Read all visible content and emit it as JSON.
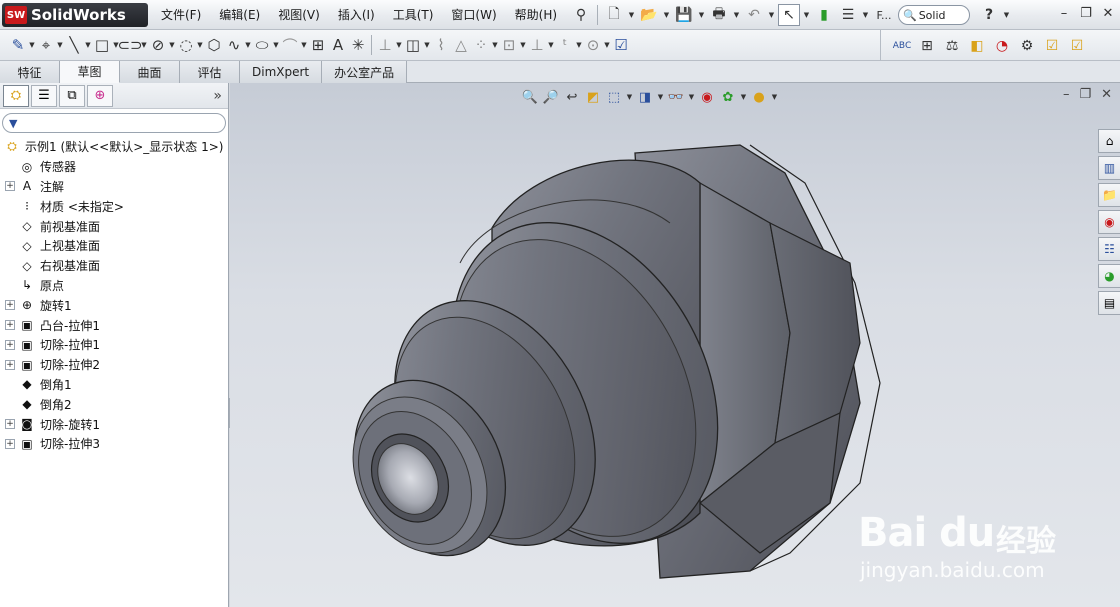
{
  "app": {
    "logo_badge": "SW",
    "logo_name": "SolidWorks"
  },
  "menu": [
    "文件(F)",
    "编辑(E)",
    "视图(V)",
    "插入(I)",
    "工具(T)",
    "窗口(W)",
    "帮助(H)"
  ],
  "menubar_toolbar": {
    "icons": [
      "pin-icon",
      "new-document-icon",
      "open-icon",
      "save-icon",
      "print-icon",
      "undo-icon",
      "select-icon",
      "traffic-light-icon",
      "options-icon",
      "rebuild-icon"
    ],
    "rebuild_label": "F...",
    "search_text": "Solid",
    "help_glyph": "?"
  },
  "window_controls": [
    "–",
    "❐",
    "✕"
  ],
  "sketch_toolbar": {
    "icons": [
      "sketch-icon",
      "smart-dimension-icon",
      "line-icon",
      "rectangle-icon",
      "slot-icon",
      "circle-icon",
      "center-arc-icon",
      "polygon-icon",
      "spline-icon",
      "ellipse-icon",
      "fillet-sketch-icon",
      "text-icon",
      "point-icon",
      "mirror-icon",
      "offset-icon",
      "trim-icon",
      "construction-icon",
      "linear-pattern-icon",
      "move-icon",
      "relations-icon",
      "repair-icon",
      "quick-snaps-icon"
    ]
  },
  "evaluate_toolbar": {
    "icons": [
      "spell-check-icon",
      "measure-icon",
      "mass-properties-icon",
      "section-properties-icon",
      "statistics-icon",
      "check-icon",
      "checkbox-icon"
    ]
  },
  "tabs": [
    {
      "label": "特征",
      "active": false
    },
    {
      "label": "草图",
      "active": true
    },
    {
      "label": "曲面",
      "active": false
    },
    {
      "label": "评估",
      "active": false
    },
    {
      "label": "DimXpert",
      "active": false
    },
    {
      "label": "办公室产品",
      "active": false
    }
  ],
  "feature_manager": {
    "panel_tabs": [
      "feature-manager-icon",
      "property-manager-icon",
      "configuration-manager-icon",
      "dimxpert-manager-icon"
    ],
    "more": "»",
    "root": "示例1  (默认<<默认>_显示状态 1>)",
    "items": [
      {
        "label": "传感器",
        "expander": "",
        "icon": "sensor-icon",
        "glyph": "◎"
      },
      {
        "label": "注解",
        "expander": "+",
        "icon": "annotation-icon",
        "glyph": "A"
      },
      {
        "label": "材质 <未指定>",
        "expander": "",
        "icon": "material-icon",
        "glyph": "⁝"
      },
      {
        "label": "前视基准面",
        "expander": "",
        "icon": "plane-icon",
        "glyph": "◇"
      },
      {
        "label": "上视基准面",
        "expander": "",
        "icon": "plane-icon",
        "glyph": "◇"
      },
      {
        "label": "右视基准面",
        "expander": "",
        "icon": "plane-icon",
        "glyph": "◇"
      },
      {
        "label": "原点",
        "expander": "",
        "icon": "origin-icon",
        "glyph": "↳"
      },
      {
        "label": "旋转1",
        "expander": "+",
        "icon": "revolve-icon",
        "glyph": "⊕"
      },
      {
        "label": "凸台-拉伸1",
        "expander": "+",
        "icon": "boss-extrude-icon",
        "glyph": "▣"
      },
      {
        "label": "切除-拉伸1",
        "expander": "+",
        "icon": "cut-extrude-icon",
        "glyph": "▣"
      },
      {
        "label": "切除-拉伸2",
        "expander": "+",
        "icon": "cut-extrude-icon",
        "glyph": "▣"
      },
      {
        "label": "倒角1",
        "expander": "",
        "icon": "chamfer-icon",
        "glyph": "◆"
      },
      {
        "label": "倒角2",
        "expander": "",
        "icon": "chamfer-icon",
        "glyph": "◆"
      },
      {
        "label": "切除-旋转1",
        "expander": "+",
        "icon": "cut-revolve-icon",
        "glyph": "◙"
      },
      {
        "label": "切除-拉伸3",
        "expander": "+",
        "icon": "cut-extrude-icon",
        "glyph": "▣"
      }
    ]
  },
  "heads_up_toolbar": {
    "icons": [
      "zoom-to-fit-icon",
      "zoom-to-area-icon",
      "previous-view-icon",
      "section-view-icon",
      "view-orientation-icon",
      "display-style-icon",
      "hide-show-items-icon",
      "edit-appearance-icon",
      "apply-scene-icon",
      "view-settings-icon"
    ]
  },
  "viewport_controls": [
    "–",
    "❐",
    "✕"
  ],
  "task_pane": [
    "solidworks-resources-icon",
    "design-library-icon",
    "file-explorer-icon",
    "view-palette-icon",
    "appearances-icon",
    "custom-properties-icon",
    "document-recovery-icon"
  ],
  "watermark": {
    "brand": "Bai du",
    "brand_cn": "经验",
    "url": "jingyan.baidu.com"
  },
  "colors": {
    "viewport_top": "#c6ccd6",
    "viewport_bottom": "#e3e6eb",
    "model": "#6b6e78",
    "accent": "#c8191c"
  }
}
